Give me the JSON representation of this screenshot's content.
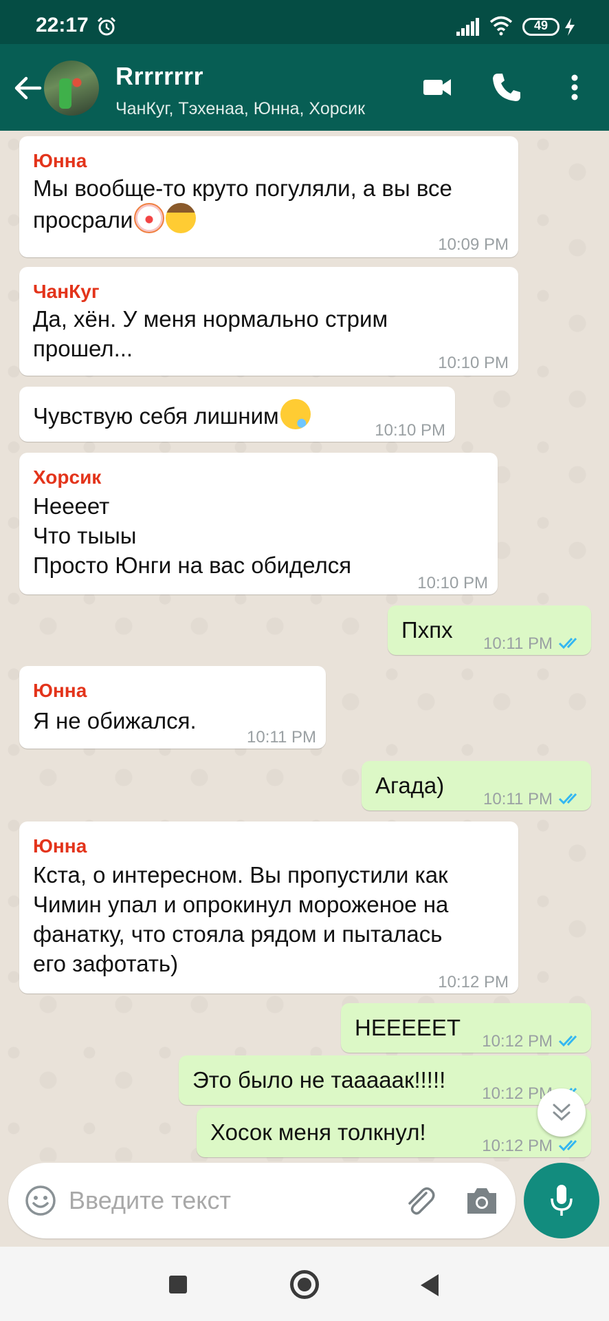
{
  "status_bar": {
    "time": "22:17",
    "battery": "49"
  },
  "header": {
    "title": "Rrrrrrrr",
    "participants": "ЧанКуг, Тэхенаа, Юнна, Хорсик"
  },
  "messages": [
    {
      "sender": "Юнна",
      "text": "Мы вообще-то круто погуляли, а вы все\nпросрали",
      "emojis": [
        "clown-emoji",
        "cowboy-emoji"
      ],
      "time": "10:09 PM"
    },
    {
      "sender": "ЧанКуг",
      "text": "Да, хён. У меня нормально стрим\nпрошел...",
      "time": "10:10 PM"
    },
    {
      "text": "Чувствую себя лишним",
      "emojis": [
        "sleepy-emoji"
      ],
      "time": "10:10 PM"
    },
    {
      "sender": "Хорсик",
      "text": "Неееет\nЧто тыыы\nПросто Юнги на вас обиделся",
      "time": "10:10 PM"
    },
    {
      "text": "Пхпх",
      "time": "10:11 PM",
      "outgoing": true
    },
    {
      "sender": "Юнна",
      "text": "Я не обижался.",
      "time": "10:11 PM"
    },
    {
      "text": "Агада)",
      "time": "10:11 PM",
      "outgoing": true
    },
    {
      "sender": "Юнна",
      "text": "Кста, о интересном. Вы пропустили как\nЧимин упал и опрокинул мороженое на\nфанатку, что стояла рядом и пыталась\nего зафотать)",
      "time": "10:12 PM"
    },
    {
      "text": "НЕЕЕЕЕТ",
      "time": "10:12 PM",
      "outgoing": true
    },
    {
      "text": "Это было не тааааак!!!!!",
      "time": "10:12 PM",
      "outgoing": true
    },
    {
      "text": "Хосок меня толкнул!",
      "time": "10:12 PM",
      "outgoing": true
    }
  ],
  "input": {
    "placeholder": "Введите текст"
  },
  "colors": {
    "header": "#075e54",
    "status_bar": "#054d44",
    "sender_name": "#e3341b",
    "outgoing_bubble": "#dcf8c6",
    "read_ticks": "#34b7f1",
    "mic_button": "#128c7e"
  }
}
